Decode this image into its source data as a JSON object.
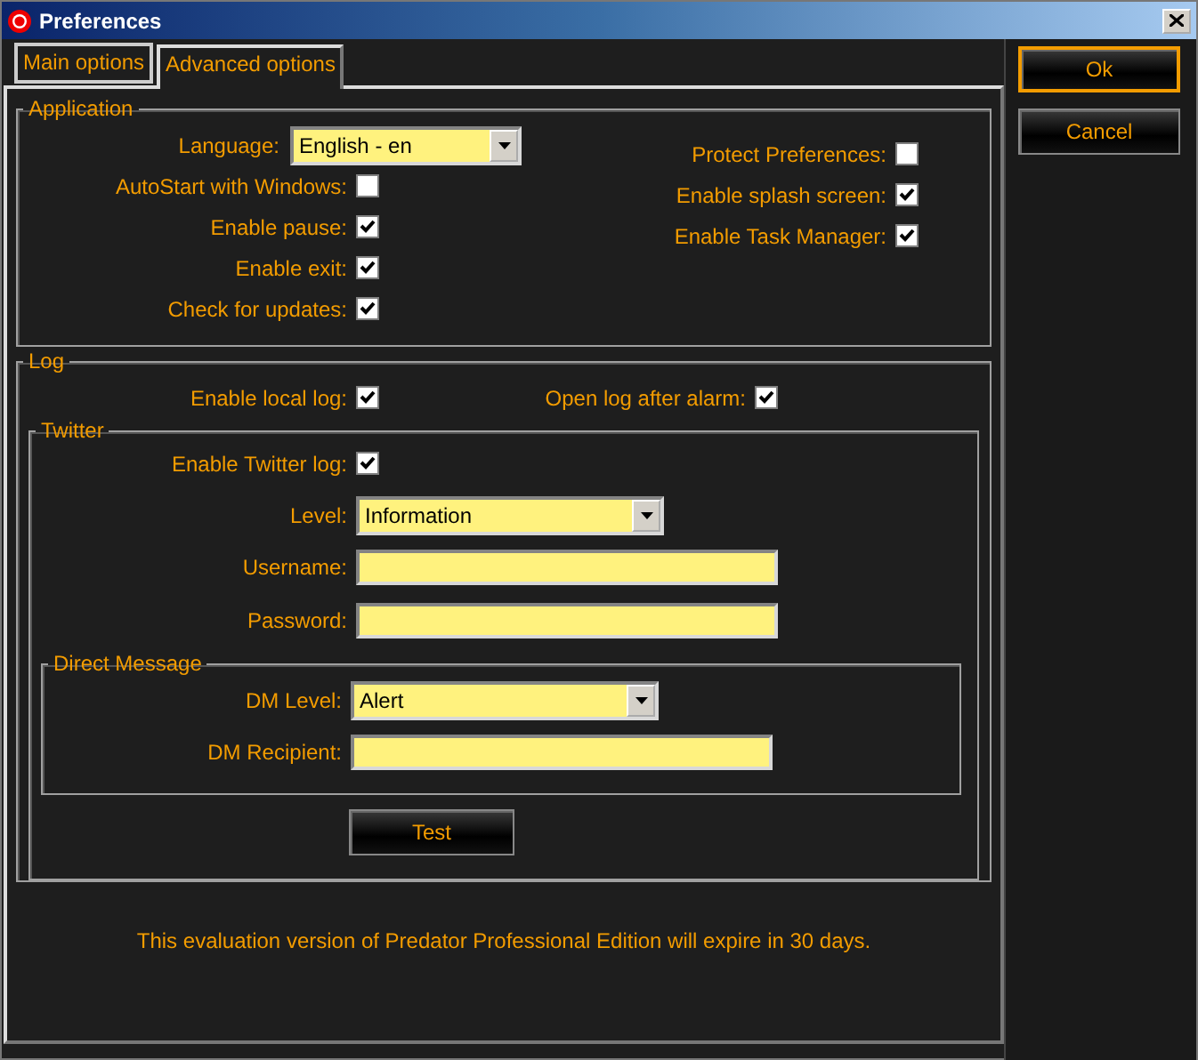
{
  "window": {
    "title": "Preferences"
  },
  "tabs": [
    {
      "label": "Main options",
      "selected": false
    },
    {
      "label": "Advanced options",
      "selected": true
    }
  ],
  "application": {
    "title": "Application",
    "language": {
      "label": "Language:",
      "value": "English - en"
    },
    "left_options": [
      {
        "label": "AutoStart with Windows:",
        "checked": false
      },
      {
        "label": "Enable pause:",
        "checked": true
      },
      {
        "label": "Enable exit:",
        "checked": true
      },
      {
        "label": "Check for updates:",
        "checked": true
      }
    ],
    "right_options": [
      {
        "label": "Protect Preferences:",
        "checked": false
      },
      {
        "label": "Enable splash screen:",
        "checked": true
      },
      {
        "label": "Enable Task Manager:",
        "checked": true
      }
    ]
  },
  "log": {
    "title": "Log",
    "options": [
      {
        "label": "Enable local log:",
        "checked": true
      },
      {
        "label": "Open log after alarm:",
        "checked": true
      }
    ],
    "twitter": {
      "title": "Twitter",
      "enable": {
        "label": "Enable Twitter log:",
        "checked": true
      },
      "level": {
        "label": "Level:",
        "value": "Information"
      },
      "username": {
        "label": "Username:"
      },
      "password": {
        "label": "Password:"
      },
      "direct_message": {
        "title": "Direct Message",
        "level": {
          "label": "DM Level:",
          "value": "Alert"
        },
        "recipient": {
          "label": "DM Recipient:"
        }
      },
      "test_button": "Test"
    }
  },
  "notice": "This evaluation version of Predator Professional Edition will expire in 30 days.",
  "buttons": [
    {
      "label": "Ok",
      "default": true
    },
    {
      "label": "Cancel",
      "default": false
    }
  ]
}
